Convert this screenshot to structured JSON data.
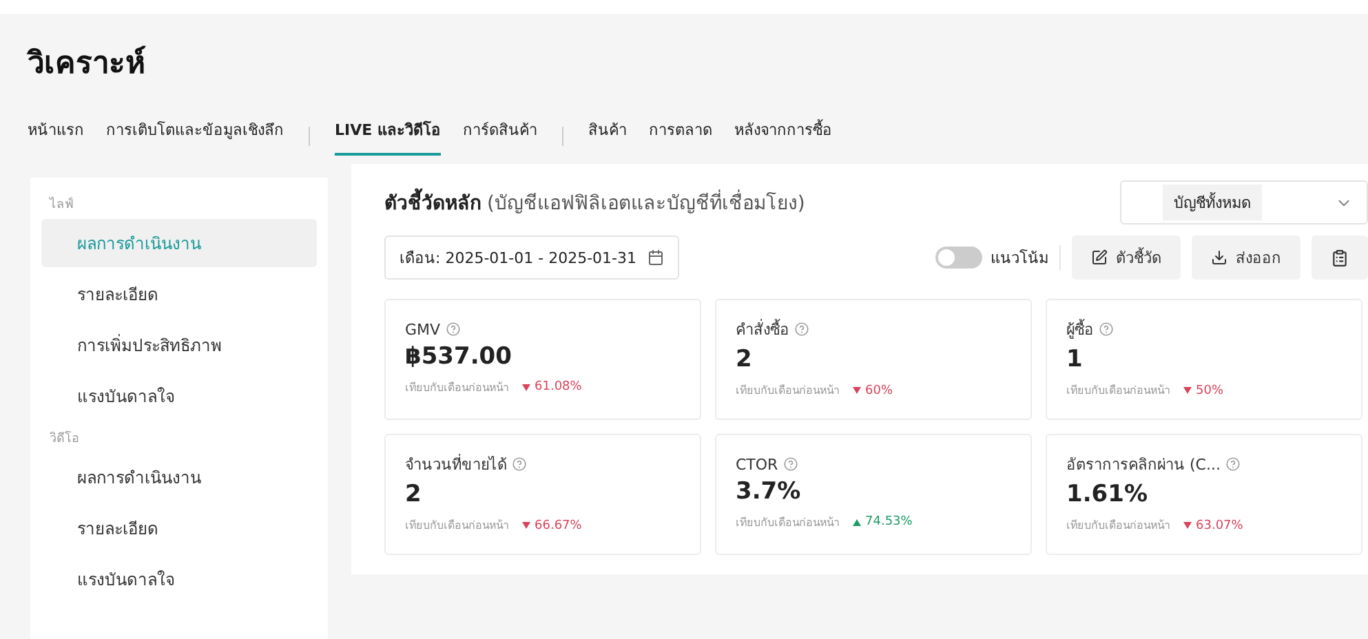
{
  "page_title": "วิเคราะห์",
  "tab_groups": [
    {
      "tabs": [
        {
          "label": "หน้าแรก",
          "selected": false
        },
        {
          "label": "การเติบโตและข้อมูลเชิงลึก",
          "selected": false
        }
      ]
    },
    {
      "tabs": [
        {
          "label": "LIVE และวิดีโอ",
          "selected": true
        },
        {
          "label": "การ์ดสินค้า",
          "selected": false
        }
      ]
    },
    {
      "tabs": [
        {
          "label": "สินค้า",
          "selected": false
        },
        {
          "label": "การตลาด",
          "selected": false
        },
        {
          "label": "หลังจากการซื้อ",
          "selected": false
        }
      ]
    }
  ],
  "sidebar": {
    "sections": [
      {
        "label": "ไลฟ์",
        "items": [
          {
            "label": "ผลการดำเนินงาน",
            "selected": true
          },
          {
            "label": "รายละเอียด",
            "selected": false
          },
          {
            "label": "การเพิ่มประสิทธิภาพ",
            "selected": false
          },
          {
            "label": "แรงบันดาลใจ",
            "selected": false
          }
        ]
      },
      {
        "label": "วิดีโอ",
        "items": [
          {
            "label": "ผลการดำเนินงาน",
            "selected": false
          },
          {
            "label": "รายละเอียด",
            "selected": false
          },
          {
            "label": "แรงบันดาลใจ",
            "selected": false
          }
        ]
      }
    ]
  },
  "main": {
    "title": "**ตัวชี้วัดหลัก** (บัญชีแอฟฟิลิเอตและบัญชีที่เชื่อมโยง)",
    "account_select": {
      "value": "บัญชีทั้งหมด"
    },
    "date_range": {
      "value": "เดือน: 2025-01-01 - 2025-01-31"
    },
    "trend_toggle": {
      "label": "แนวโน้ม",
      "on": false
    },
    "buttons": [
      {
        "kind": "metrics",
        "label": "ตัวชี้วัด"
      },
      {
        "kind": "export",
        "label": "ส่งออก"
      },
      {
        "kind": "report"
      }
    ],
    "cards": [
      {
        "title": "GMV",
        "value": "฿537.00",
        "compare": "เทียบกับเดือนก่อนหน้า",
        "change": "61.08%",
        "kind": "down"
      },
      {
        "title": "คำสั่งซื้อ",
        "value": "2",
        "compare": "เทียบกับเดือนก่อนหน้า",
        "change": "60%",
        "kind": "down"
      },
      {
        "title": "ผู้ซื้อ",
        "value": "1",
        "compare": "เทียบกับเดือนก่อนหน้า",
        "change": "50%",
        "kind": "down"
      },
      {
        "title": "จำนวนที่ขายได้",
        "value": "2",
        "compare": "เทียบกับเดือนก่อนหน้า",
        "change": "66.67%",
        "kind": "down"
      },
      {
        "title": "CTOR",
        "value": "3.7%",
        "compare": "เทียบกับเดือนก่อนหน้า",
        "change": "74.53%",
        "kind": "up"
      },
      {
        "title": "อัตราการคลิกผ่าน (C...",
        "value": "1.61%",
        "compare": "เทียบกับเดือนก่อนหน้า",
        "change": "63.07%",
        "kind": "down"
      }
    ]
  }
}
